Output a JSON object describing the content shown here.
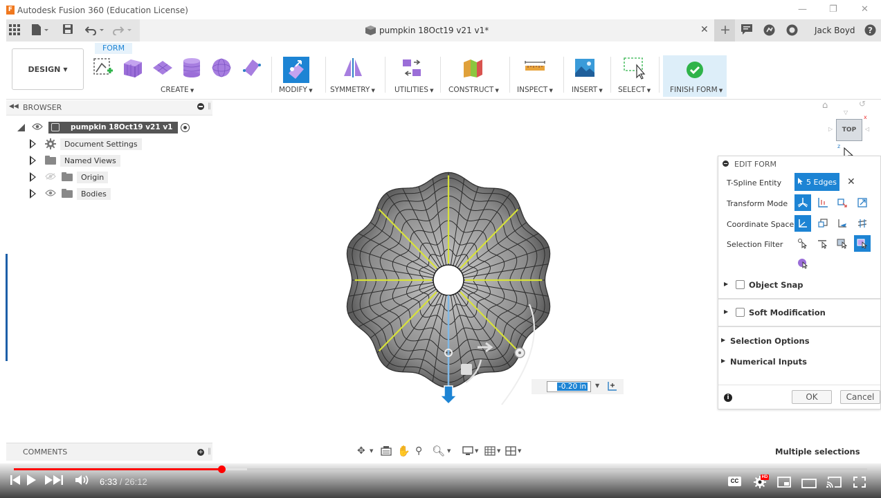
{
  "window": {
    "title": "Autodesk Fusion 360 (Education License)",
    "logo_letter": "F"
  },
  "tabbar": {
    "doc_title": "pumpkin 18Oct19 v21 v1*",
    "user_name": "Jack Boyd"
  },
  "toolbar": {
    "workspace": "DESIGN",
    "active_tab": "FORM",
    "groups": {
      "create": "CREATE",
      "modify": "MODIFY",
      "symmetry": "SYMMETRY",
      "utilities": "UTILITIES",
      "construct": "CONSTRUCT",
      "inspect": "INSPECT",
      "insert": "INSERT",
      "select": "SELECT",
      "finish": "FINISH FORM"
    }
  },
  "browser": {
    "header": "BROWSER",
    "root": "pumpkin 18Oct19 v21 v1",
    "items": [
      {
        "label": "Document Settings"
      },
      {
        "label": "Named Views"
      },
      {
        "label": "Origin"
      },
      {
        "label": "Bodies"
      }
    ]
  },
  "viewcube": {
    "face": "TOP"
  },
  "edit_form": {
    "header": "EDIT FORM",
    "tspline_label": "T-Spline Entity",
    "tspline_value": "5 Edges",
    "transform_label": "Transform Mode",
    "coord_label": "Coordinate Space",
    "filter_label": "Selection Filter",
    "object_snap": "Object Snap",
    "soft_mod": "Soft Modification",
    "selection_options": "Selection Options",
    "numerical_inputs": "Numerical Inputs",
    "ok": "OK",
    "cancel": "Cancel"
  },
  "viewport": {
    "distance_value": "-0.20 in"
  },
  "comments": {
    "label": "COMMENTS"
  },
  "status": {
    "text": "Multiple selections"
  },
  "player": {
    "current": "6:33",
    "separator": " / ",
    "duration": "26:12",
    "progress_fraction": 0.243,
    "buffered_fraction": 0.273,
    "hd_badge": "HD",
    "cc_label": "CC"
  },
  "colors": {
    "accent": "#1d84d4",
    "finish_green": "#2fb34a",
    "edge_yellow": "#d8e23a",
    "progress_red": "#ff0000"
  }
}
